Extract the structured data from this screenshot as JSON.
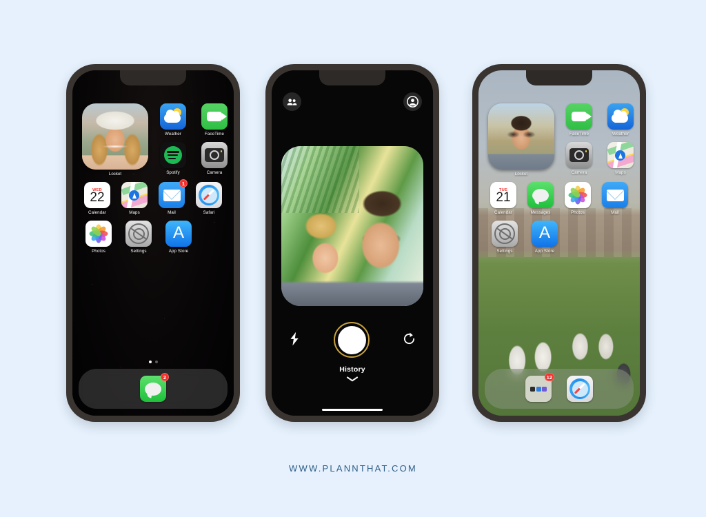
{
  "page": {
    "background_color": "#e6f1fd",
    "footer_text": "WWW.PLANNTHAT.COM",
    "footer_color": "#2e5f86"
  },
  "phones": [
    {
      "id": "phone-home-dark",
      "name": "iphone-home-screen-dark",
      "wallpaper": "dark-space",
      "widget": {
        "name": "locket-widget",
        "label": "Locket",
        "photo_description": "blonde-woman-white-bucket-hat-selfie"
      },
      "apps": [
        {
          "label": "Weather",
          "icon": "weather-icon",
          "badge": null
        },
        {
          "label": "FaceTime",
          "icon": "facetime-icon",
          "badge": null
        },
        {
          "label": "Spotify",
          "icon": "spotify-icon",
          "badge": null
        },
        {
          "label": "Camera",
          "icon": "camera-icon",
          "badge": null
        },
        {
          "label": "Calendar",
          "icon": "calendar-icon",
          "badge": null,
          "day_of_week": "WED",
          "day_number": "22"
        },
        {
          "label": "Maps",
          "icon": "maps-icon",
          "badge": null
        },
        {
          "label": "Mail",
          "icon": "mail-icon",
          "badge": "1"
        },
        {
          "label": "Safari",
          "icon": "safari-icon",
          "badge": null
        },
        {
          "label": "Photos",
          "icon": "photos-icon",
          "badge": null
        },
        {
          "label": "Settings",
          "icon": "settings-icon",
          "badge": null
        },
        {
          "label": "App Store",
          "icon": "app-store-icon",
          "badge": null
        }
      ],
      "page_dots": {
        "count": 2,
        "active_index": 0
      },
      "dock": [
        {
          "label": "Messages",
          "icon": "messages-icon",
          "badge": "2"
        }
      ]
    },
    {
      "id": "phone-locket-camera",
      "name": "locket-camera-app",
      "top_left_icon": "friends-icon",
      "top_right_icon": "profile-icon",
      "photo_description": "couple-selfie-green-ceiling",
      "controls": {
        "flash_icon": "flash-icon",
        "shutter_label": "shutter-button",
        "flip_icon": "flip-camera-icon"
      },
      "history_label": "History",
      "history_chevron": "chevron-down-icon"
    },
    {
      "id": "phone-home-light",
      "name": "iphone-home-screen-light",
      "wallpaper": "outdoor-park-shoes",
      "widget": {
        "name": "locket-widget",
        "label": "Locket",
        "photo_description": "man-glasses-hills-selfie"
      },
      "apps": [
        {
          "label": "FaceTime",
          "icon": "facetime-icon",
          "badge": null
        },
        {
          "label": "Weather",
          "icon": "weather-icon",
          "badge": null
        },
        {
          "label": "Camera",
          "icon": "camera-icon",
          "badge": null
        },
        {
          "label": "Maps",
          "icon": "maps-icon",
          "badge": null
        },
        {
          "label": "Calendar",
          "icon": "calendar-icon",
          "badge": null,
          "day_of_week": "TUE",
          "day_number": "21"
        },
        {
          "label": "Messages",
          "icon": "messages-icon",
          "badge": null
        },
        {
          "label": "Photos",
          "icon": "photos-icon",
          "badge": null
        },
        {
          "label": "Mail",
          "icon": "mail-icon",
          "badge": null
        },
        {
          "label": "Settings",
          "icon": "settings-icon",
          "badge": null
        },
        {
          "label": "App Store",
          "icon": "app-store-icon",
          "badge": null
        }
      ],
      "dock": [
        {
          "label": "",
          "icon": "folder-icon",
          "badge": "12"
        },
        {
          "label": "",
          "icon": "safari-icon",
          "badge": null
        }
      ]
    }
  ],
  "colors": {
    "badge_red": "#f5302c",
    "shutter_ring": "#c8a13f",
    "accent_green": "#1fc03c",
    "accent_blue": "#1a7fe8"
  }
}
